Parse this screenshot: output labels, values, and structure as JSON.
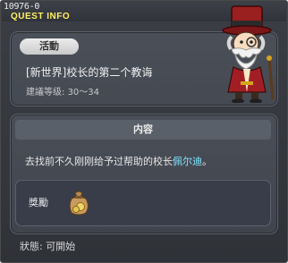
{
  "window": {
    "quest_id": "10976-0",
    "title": "QUEST INFO"
  },
  "quest": {
    "badge": "活動",
    "name": "[新世界]校长的第二个教诲",
    "level_label": "建議等级:",
    "level_range": "30～34"
  },
  "content": {
    "header": "内容",
    "description_prefix": "去找前不久刚刚给予过帮助的校长",
    "npc_name": "佩尔迪",
    "description_suffix": "。"
  },
  "reward": {
    "label": "獎勵",
    "item_icon": "money-bag-icon"
  },
  "status": {
    "label": "狀態:",
    "value": "可開始"
  },
  "npc": {
    "icon": "principal-npc-figure"
  },
  "colors": {
    "title": "#ffee66",
    "npc_highlight": "#7fe6ff",
    "panel": "#454951",
    "window": "#33363c"
  }
}
